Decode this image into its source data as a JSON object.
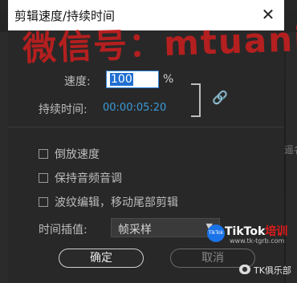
{
  "window": {
    "title": "剪辑速度/持续时间",
    "close_glyph": "✕"
  },
  "speed": {
    "label": "速度:",
    "value": "100",
    "unit": "%"
  },
  "duration": {
    "label": "持续时间:",
    "value": "00:00:05:20"
  },
  "link_glyph": "🔗",
  "checkboxes": [
    {
      "label": "倒放速度",
      "checked": false
    },
    {
      "label": "保持音频音调",
      "checked": false
    },
    {
      "label": "波纹编辑，移动尾部剪辑",
      "checked": false
    }
  ],
  "interpolation": {
    "label": "时间插值:",
    "selected": "帧采样"
  },
  "buttons": {
    "ok": "确定",
    "cancel": "取消"
  },
  "watermark": {
    "text": "微信号：mtuanide"
  },
  "badge": {
    "logo_text": "TikTok",
    "title": "TikTok",
    "title_red": "培训",
    "url": "www.tk-tgrb.com",
    "account": "TK俱乐部"
  },
  "background": {
    "side_text": "遥名"
  }
}
